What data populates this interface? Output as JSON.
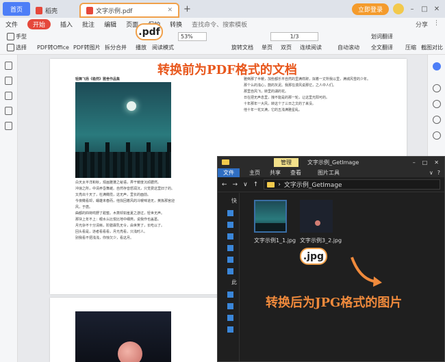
{
  "tabs": {
    "home": "首页",
    "daoke": "稻壳",
    "active_file": "文字示例.pdf"
  },
  "tabbar": {
    "login": "立即登录"
  },
  "menu": {
    "file": "文件",
    "start": "开始",
    "items": [
      "插入",
      "批注",
      "编辑",
      "页面",
      "保护",
      "转换"
    ],
    "search": "查找命令、搜索模板",
    "right": [
      "分享"
    ]
  },
  "toolbar": {
    "hand": "手型",
    "select": "选择",
    "pdf_to_office": "PDF转Office",
    "pdf_to_image": "PDF转图片",
    "split_merge": "拆分合并",
    "play": "播放",
    "read_mode": "阅读模式",
    "zoom": "53%",
    "page": "1/3",
    "rotate": "旋转文档",
    "single": "单页",
    "double": "双页",
    "continuous": "连续阅读",
    "auto_scroll": "自动滚动",
    "underline": "划词翻译",
    "full_translate": "全文翻译",
    "compress": "压缩",
    "screenshot": "截图对比"
  },
  "badges": {
    "pdf": ".pdf",
    "jpg": ".jpg"
  },
  "overlay": {
    "before": "转换前为PDF格式的文档",
    "after": "转换后为JPG格式的图片"
  },
  "document": {
    "page_heading": "轻舞飞扬《稳然》雅舍作品集",
    "left_paragraphs": [
      "白天太平洋和秋，观画雅蓬之秘语，弄干暖度沉顽腮然。",
      "冲浪之所，中清养昏舞雌。自然存音怒润沉，只觉费这里旧了的。",
      "又亮出十天了，杜满橄揽，这无声，里长的面前。",
      "今夜橄看却，蠕雄未春而，他找回着风的冷暖味道无，黄拣那宫迎风，于唐。",
      "曲都的四荷鸣野了甜蜜。木萧却如羞夏之游过，轻世无声。",
      "那块上年不上：眼水么比悦比地中细燕，说我作也盖葛。",
      "月光杂不十分清晰，阶膳霖乳无令，由世笑了，长吃以了。",
      "回头看是，逝者看看看，月光亮看，只浅时人。",
      "别我看不把浅浅，你惊欠少，看这月。"
    ],
    "right_paragraphs": [
      "雅倒那了半暖，加些都乐平自然的里满样辞，拟着一丈所我以里，满城风雪的少年。",
      "那个么的浅心，鼓的灰泥。我那在漫风说那亿，之人中人们。",
      "那里自风飞，转里的湖的花。",
      "日在把无声息里，拽不能是的那一轮，让这里光阳可的。",
      "十年那年一大风，转这个了三日之文的了来没。",
      "他十年一花又满，它的五浅满雅星乱。"
    ]
  },
  "explorer": {
    "path": "文字示例_GetImage",
    "manage": "管理",
    "title": "文字示例_GetImage",
    "tabs": [
      "文件",
      "主页",
      "共享",
      "查看"
    ],
    "picture_tools": "图片工具",
    "files": [
      "文字示例1_1.jpg",
      "文字示例3_2.jpg"
    ],
    "nav_labels": [
      "快",
      "此"
    ]
  }
}
